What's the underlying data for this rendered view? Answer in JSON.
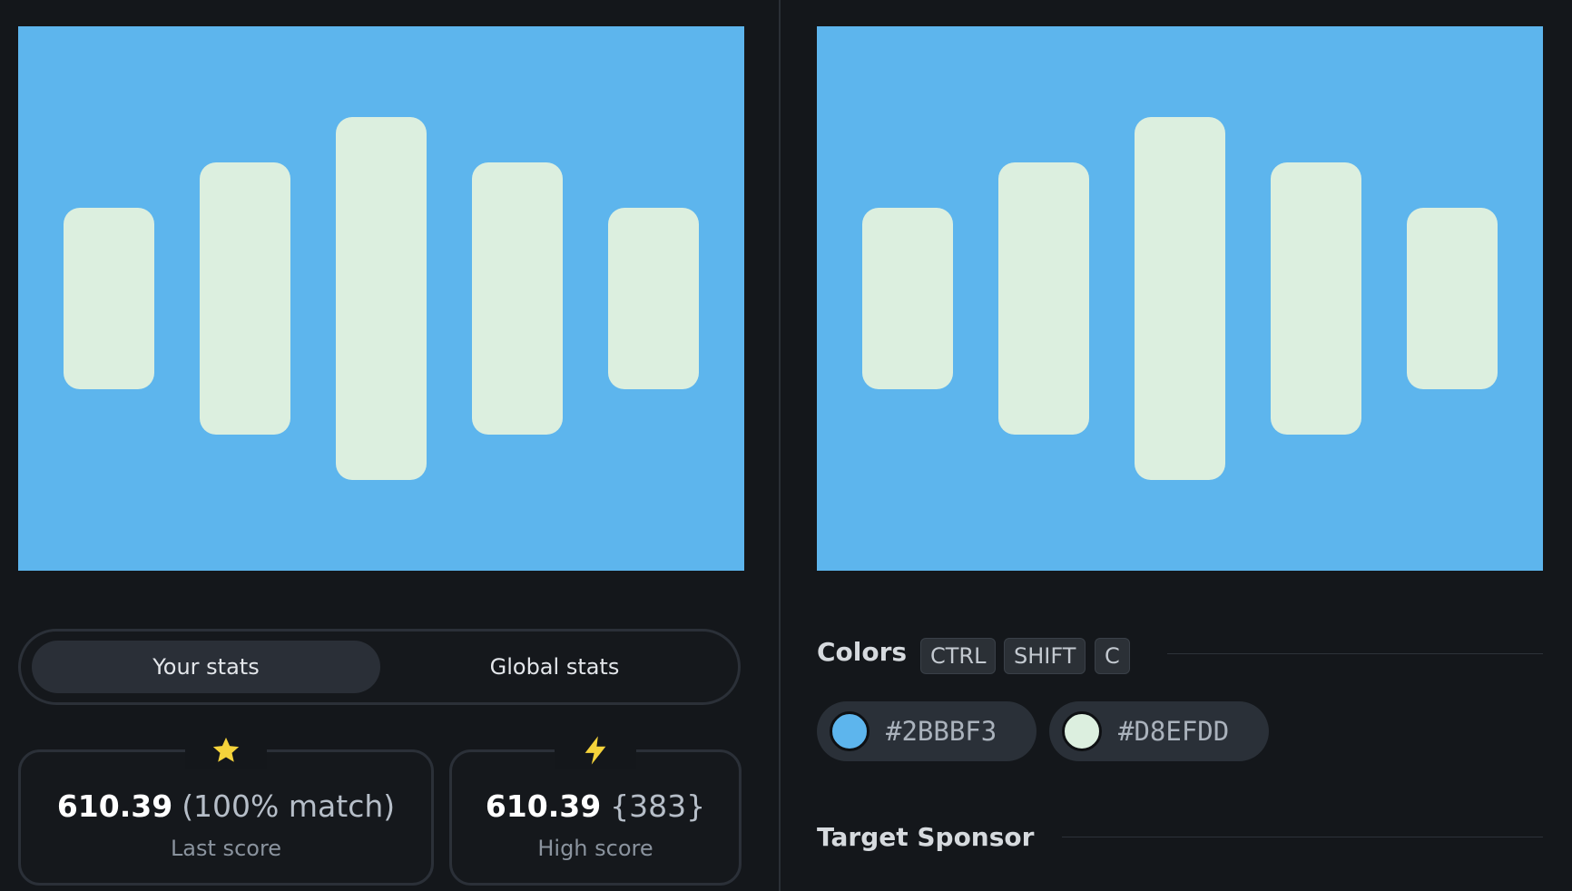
{
  "colors": {
    "background": "#2BBBF3",
    "foreground": "#D8EFDD",
    "canvas_fill": "#5db5ed",
    "bar_fill": "#dcefdf"
  },
  "stats_tabs": {
    "your_stats": "Your stats",
    "global_stats": "Global stats"
  },
  "last_score": {
    "value": "610.39",
    "extra": "(100% match)",
    "label": "Last score",
    "icon": "star-icon"
  },
  "high_score": {
    "value": "610.39",
    "extra": "{383}",
    "label": "High score",
    "icon": "lightning-icon"
  },
  "colors_section": {
    "title": "Colors",
    "shortcut": [
      "CTRL",
      "SHIFT",
      "C"
    ],
    "swatches": [
      {
        "hex": "#2BBBF3"
      },
      {
        "hex": "#D8EFDD"
      }
    ]
  },
  "sponsor_section": {
    "title": "Target Sponsor"
  }
}
